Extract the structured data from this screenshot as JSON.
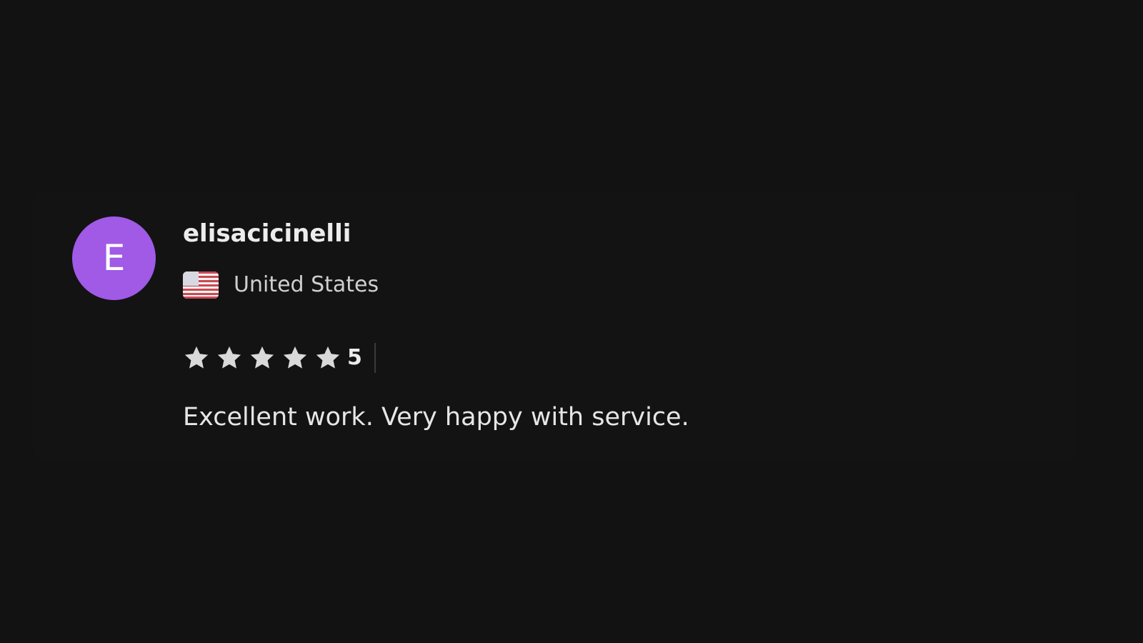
{
  "review": {
    "avatar_initial": "E",
    "avatar_color": "#a05ae6",
    "reviewer_name": "elisacicinelli",
    "country": {
      "flag_icon": "us-flag-icon",
      "name": "United States"
    },
    "rating": {
      "stars_filled": 5,
      "stars_total": 5,
      "value": "5",
      "star_color": "#d9d9d9"
    },
    "text": "Excellent work. Very happy with service."
  },
  "theme": {
    "background": "#121212",
    "text_primary": "#ececec",
    "text_secondary": "#cfcfcf"
  }
}
